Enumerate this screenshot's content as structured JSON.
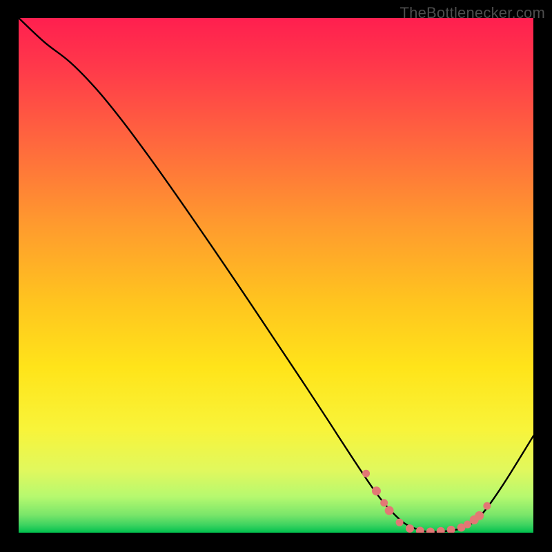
{
  "watermark": "TheBottlenecker.com",
  "chart_data": {
    "type": "line",
    "title": "",
    "xlabel": "",
    "ylabel": "",
    "xlim": [
      0,
      100
    ],
    "ylim": [
      0,
      100
    ],
    "grid": false,
    "legend": false,
    "gradient_background": {
      "top_color": "#ff1f4f",
      "mid_color": "#ffd500",
      "bottom_color": "#00cc4d",
      "note": "vertical red→orange→yellow→green gradient"
    },
    "series": [
      {
        "name": "bottleneck-curve",
        "x": [
          0,
          5,
          10,
          15,
          20,
          25,
          30,
          35,
          40,
          45,
          50,
          55,
          60,
          62,
          65,
          68,
          70,
          72,
          75,
          78,
          80,
          83,
          86,
          88,
          90,
          92,
          95,
          100
        ],
        "y": [
          100,
          95.3,
          91.4,
          86.3,
          80.2,
          73.5,
          66.5,
          59.3,
          52.0,
          44.6,
          37.1,
          29.6,
          22.0,
          18.9,
          14.3,
          9.8,
          7.0,
          4.6,
          1.8,
          0.5,
          0.2,
          0.3,
          0.8,
          1.8,
          3.6,
          6.2,
          10.7,
          18.8
        ]
      }
    ],
    "marker_clusters": [
      {
        "name": "flat-region-markers",
        "color": "#e27875",
        "points": [
          {
            "x": 67.5,
            "y": 11.5,
            "s": 5.5
          },
          {
            "x": 69.5,
            "y": 8.1,
            "s": 6.5
          },
          {
            "x": 71.0,
            "y": 5.8,
            "s": 5.5
          },
          {
            "x": 72.0,
            "y": 4.3,
            "s": 6.5
          },
          {
            "x": 74.0,
            "y": 2.0,
            "s": 5.5
          },
          {
            "x": 76.0,
            "y": 0.8,
            "s": 6.0
          },
          {
            "x": 78.0,
            "y": 0.35,
            "s": 6.0
          },
          {
            "x": 80.0,
            "y": 0.2,
            "s": 6.0
          },
          {
            "x": 82.0,
            "y": 0.3,
            "s": 6.0
          },
          {
            "x": 84.0,
            "y": 0.55,
            "s": 6.0
          },
          {
            "x": 86.0,
            "y": 1.0,
            "s": 6.0
          },
          {
            "x": 87.2,
            "y": 1.6,
            "s": 5.5
          },
          {
            "x": 88.5,
            "y": 2.5,
            "s": 6.5
          },
          {
            "x": 89.5,
            "y": 3.3,
            "s": 6.5
          },
          {
            "x": 91.0,
            "y": 5.2,
            "s": 5.5
          }
        ]
      }
    ]
  }
}
